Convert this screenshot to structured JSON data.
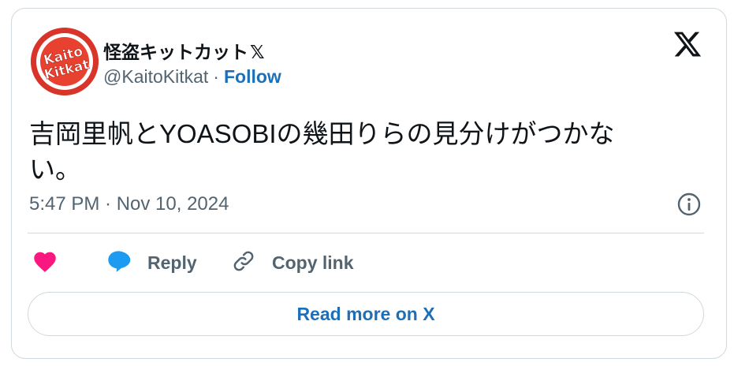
{
  "author": {
    "display_name": "怪盗キットカット",
    "badge": "𝕏",
    "handle": "@KaitoKitkat",
    "separator": "·",
    "follow_label": "Follow",
    "avatar_text_line1": "Kaito",
    "avatar_text_line2": "Kitkat"
  },
  "tweet": {
    "text": "吉岡里帆とYOASOBIの幾田りらの見分けがつかない。",
    "timestamp": "5:47 PM · Nov 10, 2024"
  },
  "actions": {
    "like_icon": "heart-icon",
    "reply_label": "Reply",
    "copy_link_label": "Copy link"
  },
  "footer": {
    "read_more_label": "Read more on X"
  },
  "colors": {
    "link": "#1d70b8",
    "secondary_text": "#536471",
    "heart": "#f91880",
    "reply_bubble": "#1d9bf0",
    "border": "#cfd9de",
    "avatar_red": "#e8412f"
  }
}
